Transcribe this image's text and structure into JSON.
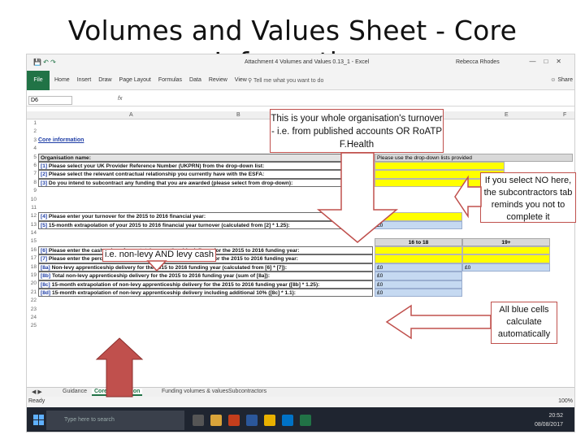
{
  "slide_title": "Volumes and Values Sheet  - Core Information",
  "excel": {
    "doc_title": "Attachment 4 Volumes and Values 0.13_1  -  Excel",
    "user": "Rebecca Rhodes",
    "file_tab": "File",
    "tabs": [
      "Home",
      "Insert",
      "Draw",
      "Page Layout",
      "Formulas",
      "Data",
      "Review",
      "View"
    ],
    "tell_me": "Tell me what you want to do",
    "share": "Share",
    "name_box": "D6",
    "fx": "fx",
    "columns": [
      "A",
      "B",
      "C",
      "D",
      "E",
      "F"
    ],
    "row_numbers": [
      "1",
      "2",
      "3",
      "4",
      "5",
      "6",
      "7",
      "8",
      "9",
      "10",
      "11",
      "12",
      "13",
      "14",
      "15",
      "16",
      "17",
      "18",
      "19",
      "20",
      "21",
      "22",
      "23",
      "24",
      "25"
    ],
    "core_info_link": "Core information",
    "org_name_label": "Organisation name:",
    "dropdown_hint": "Please use the drop-down lists provided",
    "rows": [
      {
        "pfx": "[1]",
        "text": "Please select your UK Provider Reference Number (UKPRN) from the drop-down list:"
      },
      {
        "pfx": "[2]",
        "text": "Please select the relevant contractual relationship you currently have with the ESFA:"
      },
      {
        "pfx": "[3]",
        "text": "Do you intend to subcontract any funding that you are awarded (please select from drop-down):"
      },
      {
        "pfx": "[4]",
        "text": "Please enter your turnover for the 2015 to 2016 financial year:"
      },
      {
        "pfx": "[5]",
        "text": "15-month extrapolation of your 2015 to 2016 financial year turnover (calculated from [2] * 1.25):"
      },
      {
        "pfx": "[6]",
        "text": "Please enter the cash value of your total apprenticeship delivery for the 2015 to 2016 funding year:"
      },
      {
        "pfx": "[7]",
        "text": "Please enter the percentage of non-levy apprenticeship delivery for the 2015 to 2016 funding year:"
      },
      {
        "pfx": "[8a]",
        "text": "Non-levy apprenticeship delivery for the 2015 to 2016 funding year (calculated from [6] * [7]):"
      },
      {
        "pfx": "[8b]",
        "text": "Total non-levy apprenticeship delivery for the 2015 to 2016 funding year (sum of [8a]):"
      },
      {
        "pfx": "[8c]",
        "text": "15-month extrapolation of non-levy apprenticeship delivery for the 2015 to 2016 funding year ([8b] * 1.25):"
      },
      {
        "pfx": "[8d]",
        "text": "15-month extrapolation of non-levy apprenticeship delivery including additional 10% ([8c] * 1.1):"
      }
    ],
    "age_16_18": "16 to 18",
    "age_19": "19+",
    "zero": "£0",
    "sheet_tabs": [
      "Guidance",
      "Core information",
      "Funding volumes & values",
      "Subcontractors"
    ],
    "status": "Ready",
    "zoom": "100%",
    "search_placeholder": "Type here to search",
    "clock_time": "20:52",
    "clock_date": "08/08/2017"
  },
  "callouts": {
    "turnover": "This is your whole organisation's turnover  - i.e. from published accounts OR RoATP F.Health",
    "subcontract": "If you select NO here, the subcontractors tab reminds you not to complete it",
    "nonlevy": "i.e. non-levy AND levy cash",
    "blue": "All blue cells calculate automatically"
  },
  "colors": {
    "excel_green": "#217346",
    "callout_border": "#c0504d",
    "arrow_fill": "#c0504d",
    "yellow_input": "#ffff00",
    "blue_calc": "#c5d9f1"
  }
}
